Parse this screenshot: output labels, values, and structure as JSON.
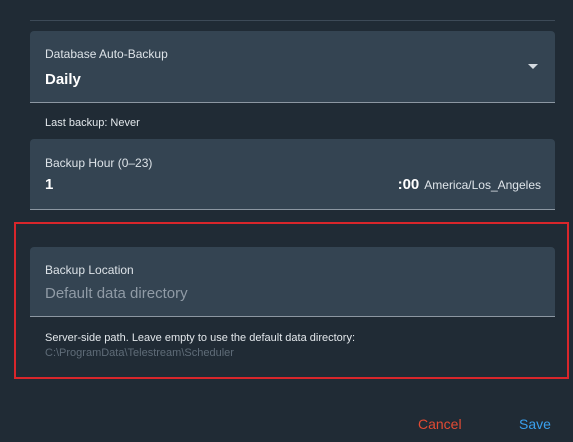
{
  "auto_backup": {
    "label": "Database Auto-Backup",
    "value": "Daily",
    "helper": "Last backup: Never"
  },
  "backup_hour": {
    "label": "Backup Hour (0–23)",
    "value": "1",
    "suffix": ":00",
    "timezone": "America/Los_Angeles"
  },
  "backup_location": {
    "label": "Backup Location",
    "placeholder": "Default data directory",
    "helper": "Server-side path. Leave empty to use the default data directory:",
    "default_path": "C:\\ProgramData\\Telestream\\Scheduler"
  },
  "actions": {
    "cancel_label": "Cancel",
    "save_label": "Save"
  },
  "colors": {
    "highlight": "#d9262b",
    "cancel": "#e24a33",
    "save": "#3aa0ee"
  }
}
